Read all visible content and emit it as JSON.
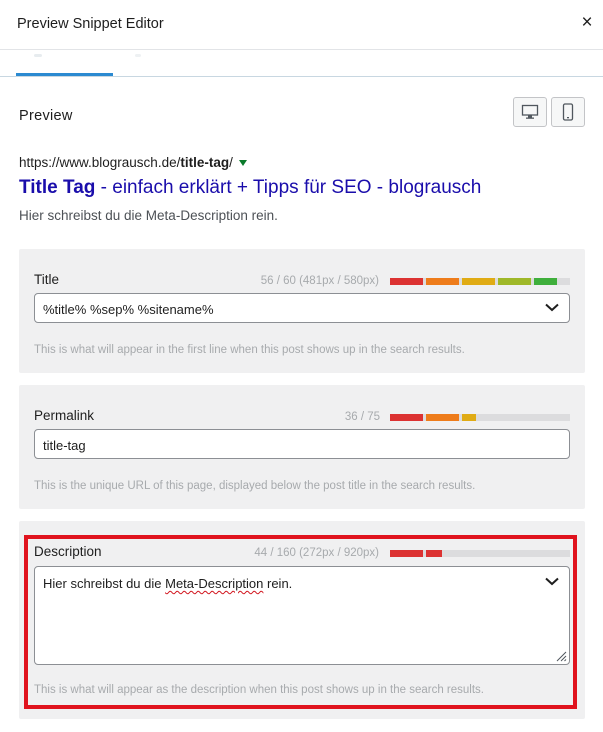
{
  "header": {
    "title": "Preview Snippet Editor",
    "close_symbol": "×"
  },
  "preview": {
    "label": "Preview",
    "serp": {
      "url_prefix": "https://www.blograusch.de/",
      "url_slug": "title-tag",
      "url_suffix": "/",
      "title_keyword": "Title Tag",
      "title_rest": " - einfach erklärt + Tipps für SEO - blograusch",
      "description": "Hier schreibst du die Meta-Description rein."
    }
  },
  "title_panel": {
    "label": "Title",
    "count": "56 / 60 (481px / 580px)",
    "progress": 0.93,
    "value": "%title% %sep% %sitename%",
    "hint": "This is what will appear in the first line when this post shows up in the search results."
  },
  "permalink_panel": {
    "label": "Permalink",
    "count": "36 / 75",
    "progress": 0.48,
    "value": "title-tag",
    "hint": "This is the unique URL of this page, displayed below the post title in the search results."
  },
  "description_panel": {
    "label": "Description",
    "count": "44 / 160 (272px / 920px)",
    "progress": 0.29,
    "value_before": "Hier schreibst du die ",
    "value_misspelled": "Meta-Description",
    "value_after": " rein.",
    "hint": "This is what will appear as the description when this post shows up in the search results."
  },
  "colors": {
    "link_blue": "#1a0dab",
    "tab_accent": "#2b8ad1",
    "highlight_red": "#e0131e",
    "bar_red": "#dc3232",
    "bar_orange": "#ee7c1b",
    "bar_yellow": "#e0ab14",
    "bar_lime": "#9fb829",
    "bar_green": "#3faf3c"
  },
  "icons": [
    "close-icon",
    "desktop-icon",
    "mobile-icon",
    "dropdown-arrow-icon",
    "chevron-down-icon",
    "resize-handle-icon"
  ]
}
